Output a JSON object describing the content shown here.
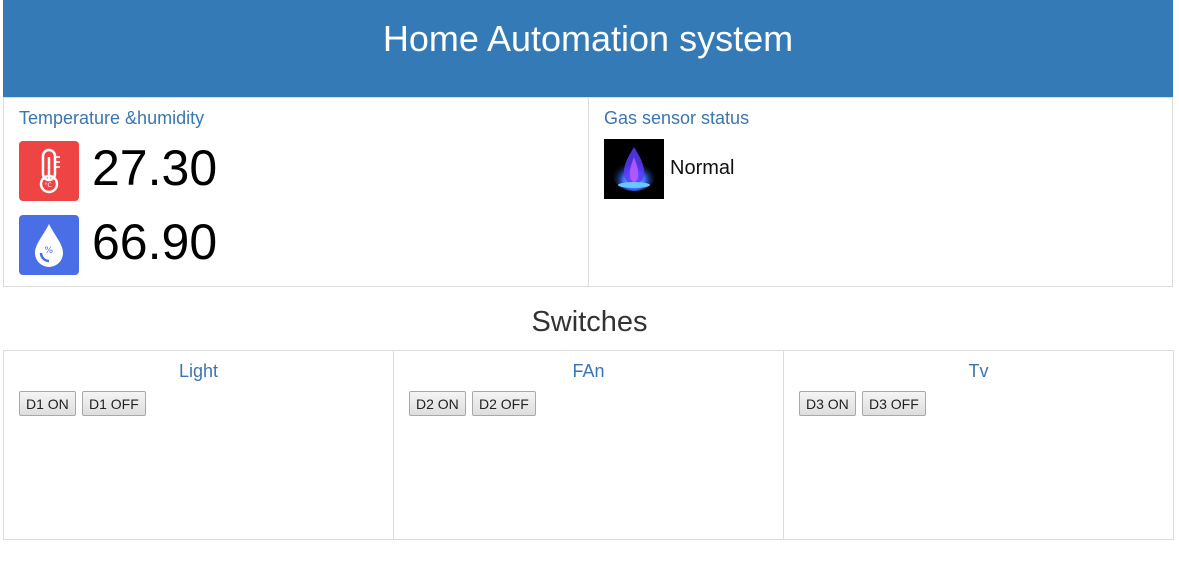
{
  "header": {
    "title": "Home Automation system"
  },
  "temperature_humidity": {
    "title": "Temperature &humidity",
    "temperature": "27.30",
    "humidity": "66.90",
    "temperature_icon": "thermometer-icon",
    "humidity_icon": "humidity-drop-icon",
    "temperature_icon_color": "#ee4444",
    "humidity_icon_color": "#4a6ee6"
  },
  "gas_sensor": {
    "title": "Gas sensor status",
    "status": "Normal",
    "icon": "gas-flame-icon"
  },
  "switches": {
    "title": "Switches",
    "groups": [
      {
        "name": "Light",
        "on_label": "D1 ON",
        "off_label": "D1 OFF"
      },
      {
        "name": "FAn",
        "on_label": "D2 ON",
        "off_label": "D2 OFF"
      },
      {
        "name": "Tv",
        "on_label": "D3 ON",
        "off_label": "D3 OFF"
      }
    ]
  },
  "colors": {
    "header_bg": "#337ab7",
    "title_text": "#3a76b0"
  }
}
